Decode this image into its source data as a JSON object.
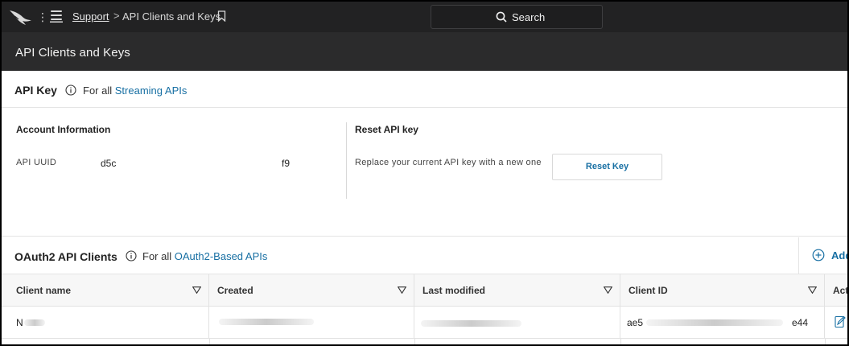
{
  "breadcrumb": {
    "home": "Support",
    "separator": ">",
    "current": "API Clients and Keys"
  },
  "search": {
    "label": "Search"
  },
  "page": {
    "title": "API Clients and Keys"
  },
  "api_key": {
    "title": "API Key",
    "note_prefix": "For all",
    "note_link": "Streaming APIs"
  },
  "account": {
    "title": "Account Information",
    "uuid_label": "API UUID",
    "uuid_start": "d5c",
    "uuid_end": "f9"
  },
  "reset": {
    "title": "Reset API key",
    "description": "Replace your current API key with a new one",
    "button": "Reset Key"
  },
  "oauth": {
    "title": "OAuth2 API Clients",
    "note_prefix": "For all",
    "note_link": "OAuth2-Based APIs",
    "add_label": "Add"
  },
  "table": {
    "columns": [
      "Client name",
      "Created",
      "Last modified",
      "Client ID",
      "Act"
    ],
    "rows": [
      {
        "client_name": "N",
        "client_id_start": "ae5",
        "client_id_end": "e44"
      }
    ]
  },
  "colors": {
    "topbar": "#222223",
    "titleband": "#2b2b2c",
    "link": "#176fa3"
  }
}
